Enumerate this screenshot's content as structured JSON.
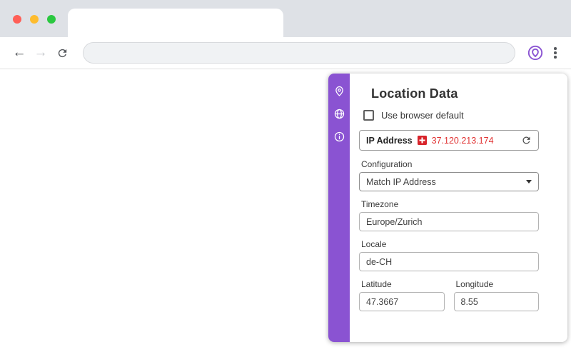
{
  "browser": {
    "back_icon": "←",
    "forward_icon": "→",
    "url": ""
  },
  "panel": {
    "title": "Location Data",
    "use_default_label": "Use browser default",
    "ip": {
      "label": "IP Address",
      "value": "37.120.213.174"
    },
    "configuration": {
      "label": "Configuration",
      "value": "Match IP Address"
    },
    "timezone": {
      "label": "Timezone",
      "value": "Europe/Zurich"
    },
    "locale": {
      "label": "Locale",
      "value": "de-CH"
    },
    "latitude": {
      "label": "Latitude",
      "value": "47.3667"
    },
    "longitude": {
      "label": "Longitude",
      "value": "8.55"
    }
  },
  "icons": {
    "sidebar": [
      "location-pin",
      "globe",
      "info"
    ],
    "toolbar_extension": "location-extension",
    "ip_flag": "swiss-flag",
    "ip_action": "refresh"
  },
  "colors": {
    "accent": "#8a53d2",
    "ip_text": "#e03131",
    "flag_red": "#d8232a"
  }
}
